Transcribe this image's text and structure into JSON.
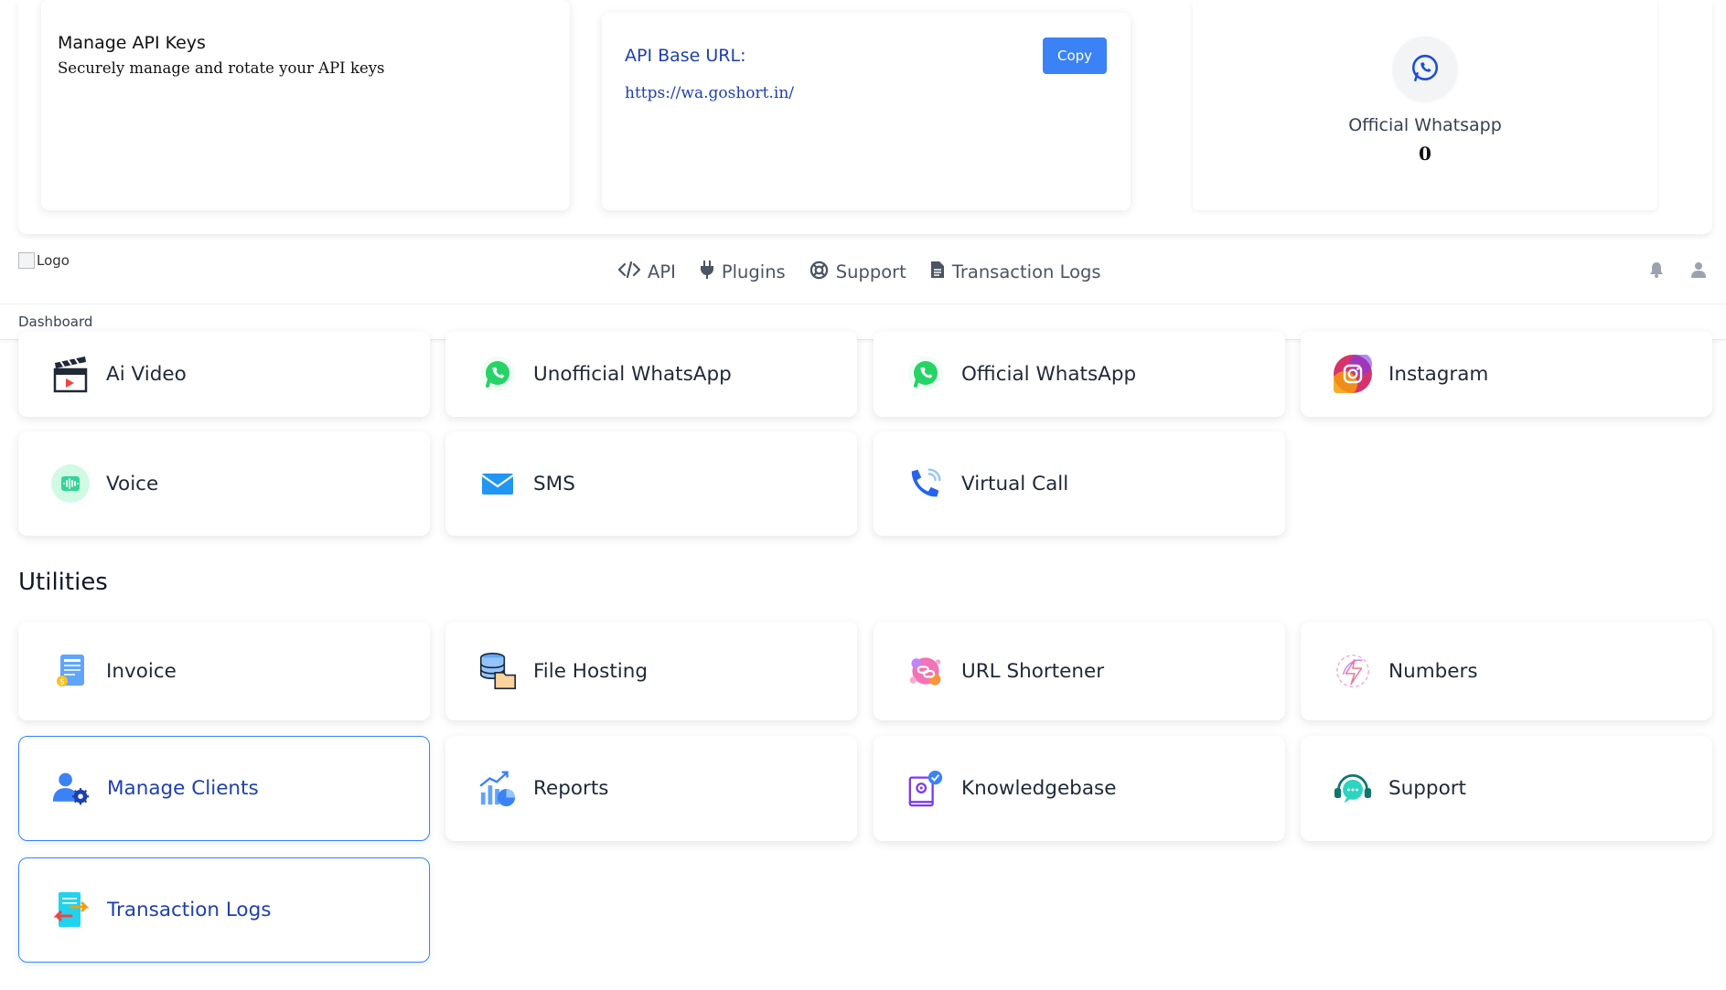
{
  "api_keys_card": {
    "title": "Manage API Keys",
    "subtitle": "Securely manage and rotate your API keys"
  },
  "base_url_card": {
    "label": "API Base URL:",
    "url": "https://wa.goshort.in/",
    "copy_label": "Copy"
  },
  "whatsapp_card": {
    "name": "Official Whatsapp",
    "count": "0"
  },
  "navbar": {
    "logo_alt": "Logo",
    "links": [
      {
        "label": "API",
        "icon": "code-icon"
      },
      {
        "label": "Plugins",
        "icon": "plug-icon"
      },
      {
        "label": "Support",
        "icon": "lifebuoy-icon"
      },
      {
        "label": "Transaction Logs",
        "icon": "file-icon"
      }
    ],
    "right_icons": [
      "bell-icon",
      "user-icon"
    ]
  },
  "breadcrumb": "Dashboard",
  "services": [
    {
      "label": "Ai Video",
      "icon": "clapperboard-icon"
    },
    {
      "label": "Unofficial WhatsApp",
      "icon": "whatsapp-icon"
    },
    {
      "label": "Official WhatsApp",
      "icon": "whatsapp-icon"
    },
    {
      "label": "Instagram",
      "icon": "instagram-icon"
    },
    {
      "label": "Voice",
      "icon": "voice-wave-icon"
    },
    {
      "label": "SMS",
      "icon": "envelope-icon"
    },
    {
      "label": "Virtual Call",
      "icon": "phone-call-icon"
    }
  ],
  "utilities_title": "Utilities",
  "utilities": [
    {
      "label": "Invoice",
      "icon": "invoice-icon"
    },
    {
      "label": "File Hosting",
      "icon": "database-folder-icon"
    },
    {
      "label": "URL Shortener",
      "icon": "link-splash-icon"
    },
    {
      "label": "Numbers",
      "icon": "numbers-icon"
    },
    {
      "label": "Manage Clients",
      "icon": "user-gear-icon"
    },
    {
      "label": "Reports",
      "icon": "chart-icon"
    },
    {
      "label": "Knowledgebase",
      "icon": "book-gear-icon"
    },
    {
      "label": "Support",
      "icon": "headset-chat-icon"
    },
    {
      "label": "Transaction Logs",
      "icon": "transaction-doc-icon"
    }
  ],
  "colors": {
    "accent": "#3b82f6",
    "accent_dark": "#1e40af",
    "whatsapp_green": "#25d366"
  }
}
